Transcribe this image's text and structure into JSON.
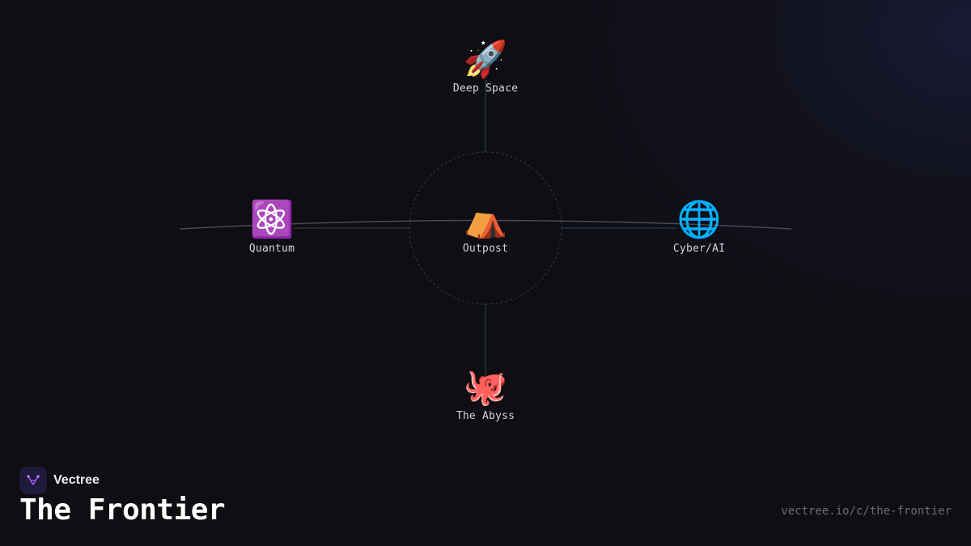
{
  "brand": {
    "name": "Vectree",
    "logo_icon": "vectree-branch-icon",
    "accent": "#9a5cf0"
  },
  "title": "The Frontier",
  "url": "vectree.io/c/the-frontier",
  "colors": {
    "background": "#0e0e13",
    "edge": "#34465e",
    "ring": "#2f3a4c",
    "label": "#d4d4dc"
  },
  "graph": {
    "center": {
      "id": "outpost",
      "label": "Outpost",
      "icon": "tent-icon",
      "emoji": "⛺"
    },
    "branches": [
      {
        "id": "deep-space",
        "label": "Deep Space",
        "icon": "rocket-icon",
        "emoji": "🚀",
        "direction": "up"
      },
      {
        "id": "quantum",
        "label": "Quantum",
        "icon": "atom-icon",
        "emoji": "⚛️",
        "direction": "left"
      },
      {
        "id": "cyber-ai",
        "label": "Cyber/AI",
        "icon": "globe-icon",
        "emoji": "🌐",
        "direction": "right"
      },
      {
        "id": "the-abyss",
        "label": "The Abyss",
        "icon": "octopus-icon",
        "emoji": "🐙",
        "direction": "down"
      }
    ]
  }
}
